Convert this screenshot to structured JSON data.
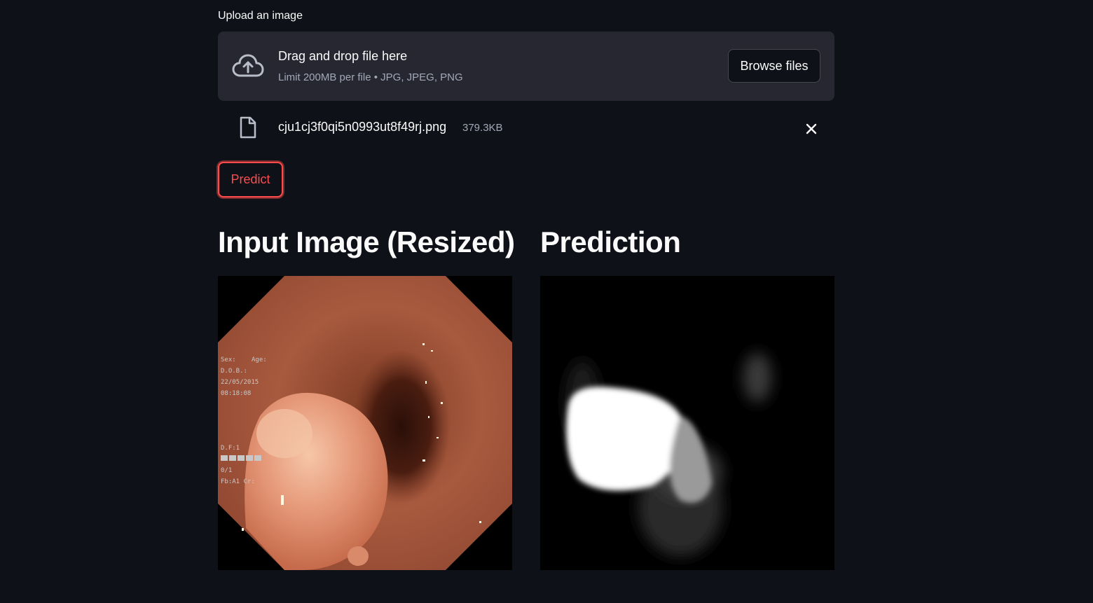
{
  "uploader": {
    "label": "Upload an image",
    "drop_title": "Drag and drop file here",
    "drop_limit": "Limit 200MB per file • JPG, JPEG, PNG",
    "browse_label": "Browse files"
  },
  "file": {
    "name": "cju1cj3f0qi5n0993ut8f49rj.png",
    "size": "379.3KB"
  },
  "actions": {
    "predict_label": "Predict"
  },
  "columns": {
    "left_title": "Input Image (Resized)",
    "right_title": "Prediction"
  },
  "endoscopy_overlay": {
    "lines": [
      "Sex:",
      "Age:",
      "D.O.B.:",
      "22/05/2015",
      "08:18:08",
      "D.F:1",
      "0/1",
      "Fb:A1 Cr:"
    ]
  },
  "colors": {
    "background": "#0e1117",
    "dropzone": "#262730",
    "accent": "#ff4b4b",
    "muted_text": "#a3a8b8"
  },
  "icons": {
    "upload": "cloud-upload-icon",
    "file": "file-icon",
    "close": "close-icon"
  }
}
